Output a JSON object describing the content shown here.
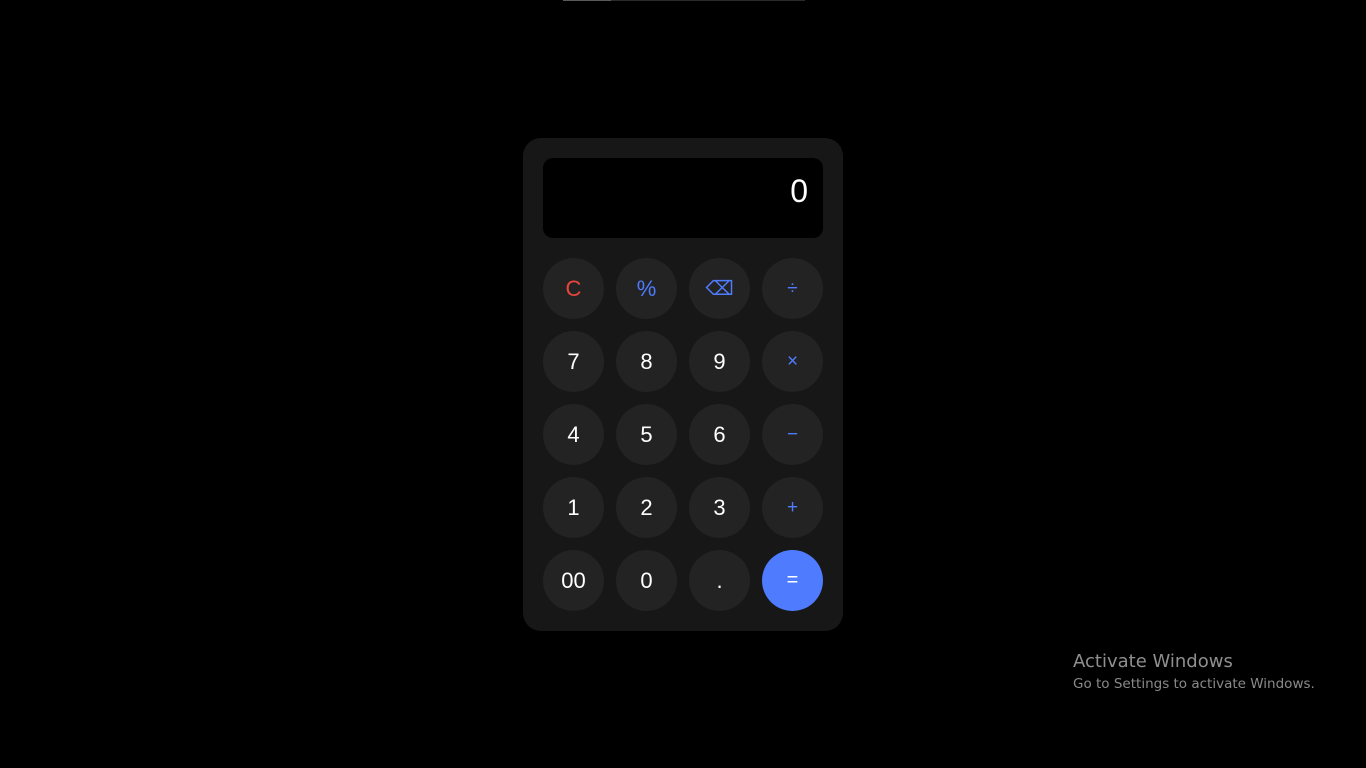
{
  "display": {
    "value": "0"
  },
  "keys": {
    "clear": "C",
    "percent": "%",
    "backspace": "⌫",
    "divide": "÷",
    "seven": "7",
    "eight": "8",
    "nine": "9",
    "multiply": "×",
    "four": "4",
    "five": "5",
    "six": "6",
    "minus": "−",
    "one": "1",
    "two": "2",
    "three": "3",
    "plus": "+",
    "double_zero": "00",
    "zero": "0",
    "decimal": ".",
    "equals": "="
  },
  "watermark": {
    "title": "Activate Windows",
    "subtitle": "Go to Settings to activate Windows."
  },
  "colors": {
    "background": "#000000",
    "panel": "#171717",
    "key": "#232323",
    "accent": "#4f7cff",
    "clear": "#e8453c"
  }
}
